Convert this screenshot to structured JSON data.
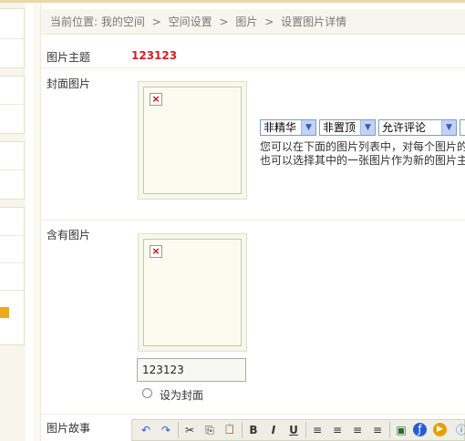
{
  "breadcrumb": {
    "prefix": "当前位置:",
    "items": [
      "我的空间",
      "空间设置",
      "图片",
      "设置图片详情"
    ],
    "separator": ">"
  },
  "form": {
    "title_label": "图片主题",
    "title_value": "123123",
    "cover_label": "封面图片",
    "contains_label": "含有图片",
    "story_label": "图片故事"
  },
  "selects": {
    "featured": "非精华",
    "pinned": "非置顶",
    "comments": "允许评论"
  },
  "hint": {
    "line1": "您可以在下面的图片列表中，对每个图片的",
    "line2": "也可以选择其中的一张图片作为新的图片主"
  },
  "picture_item": {
    "name_value": "123123",
    "set_cover_label": "设为封面"
  },
  "toolbar": {
    "undo": "↶",
    "redo": "↷",
    "cut": "✂",
    "copy": "⎘",
    "paste": "📋",
    "bold": "B",
    "italic": "I",
    "underline": "U",
    "align_left": "≡",
    "align_center": "≡",
    "align_right": "≡",
    "justify": "≡",
    "image": "▣",
    "flash": "ƒ",
    "media": "▶",
    "info": "ⓘ"
  },
  "colors": {
    "title_value": "#d42020",
    "accent": "#f0a820"
  }
}
